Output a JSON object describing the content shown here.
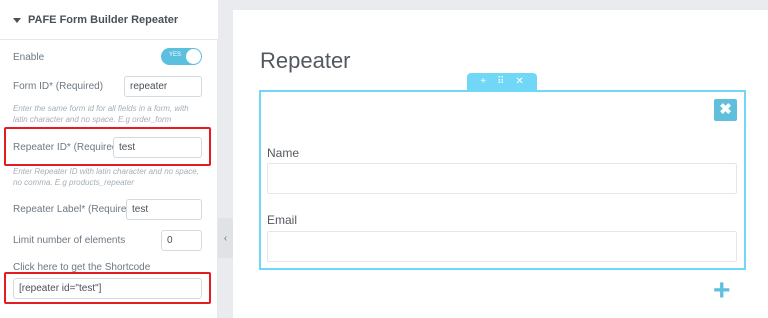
{
  "panel": {
    "section_title": "PAFE Form Builder Repeater",
    "enable": {
      "label": "Enable",
      "toggle_text": "YES",
      "on": true
    },
    "form_id": {
      "label": "Form ID* (Required)",
      "value": "repeater",
      "hint": "Enter the same form id for all fields in a form, with latin character and no space. E.g order_form"
    },
    "repeater_id": {
      "label": "Repeater ID* (Required)",
      "value": "test",
      "hint": "Enter Repeater ID with latin character and no space, no comma. E.g products_repeater"
    },
    "repeater_label": {
      "label": "Repeater Label* (Required)",
      "value": "test"
    },
    "limit": {
      "label": "Limit number of elements",
      "value": "0"
    },
    "shortcode": {
      "label": "Click here to get the Shortcode",
      "value": "[repeater id=\"test\"]"
    }
  },
  "preview": {
    "title": "Repeater",
    "tabbar": {
      "add": "+",
      "move": "⠿",
      "close": "✕"
    },
    "remove_glyph": "✖",
    "fields": [
      {
        "label": "Name"
      },
      {
        "label": "Email"
      }
    ],
    "add_glyph": "+"
  },
  "colors": {
    "accent": "#71d7f7",
    "button": "#61bfde",
    "highlight": "#e31b23",
    "toggle": "#5bc0de"
  }
}
